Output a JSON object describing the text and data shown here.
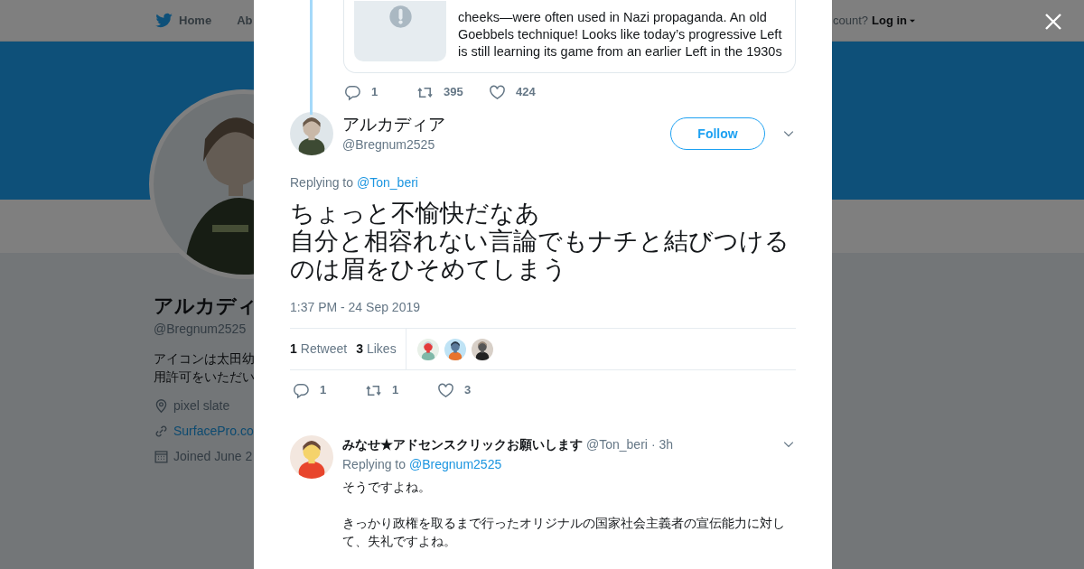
{
  "background_page": {
    "nav": {
      "home": "Home",
      "about": "Ab",
      "account_prompt": "count?",
      "login": "Log in"
    },
    "profile": {
      "name": "アルカディ",
      "handle": "@Bregnum2525",
      "bio_lines": [
        "アイコンは太田幼",
        "用許可をいただい"
      ],
      "location": "pixel slate",
      "website": "SurfacePro.co",
      "joined": "Joined June 2"
    }
  },
  "quoted_tweet": {
    "card_lines": [
      "cheeks—were often used in Nazi propaganda. An old",
      "Goebbels technique! Looks like today’s progressive Left",
      "is still learning its game from an earlier Left in the 1930s"
    ],
    "actions": {
      "replies": "1",
      "retweets": "395",
      "likes": "424"
    }
  },
  "tweet": {
    "name": "アルカディア",
    "handle": "@Bregnum2525",
    "follow": "Follow",
    "replying_label": "Replying to",
    "replying_to": "@Ton_beri",
    "text_lines": [
      "ちょっと不愉快だなあ",
      "自分と相容れない言論でもナチと結びつける",
      "のは眉をひそめてしまう"
    ],
    "time": "1:37 PM - 24 Sep 2019",
    "stats": [
      {
        "count": "1",
        "label": "Retweet"
      },
      {
        "count": "3",
        "label": "Likes"
      }
    ],
    "actions": {
      "replies": "1",
      "retweets": "1",
      "likes": "3"
    }
  },
  "reply": {
    "name": "みなせ★アドセンスクリックお願いします",
    "handle": "@Ton_beri",
    "age": "· 3h",
    "replying_label": "Replying to",
    "replying_to": "@Bregnum2525",
    "paragraphs": [
      "そうですよね。",
      "きっかり政権を取るまで行ったオリジナルの国家社会主義者の宣伝能力に対して、失礼ですよね。"
    ]
  }
}
